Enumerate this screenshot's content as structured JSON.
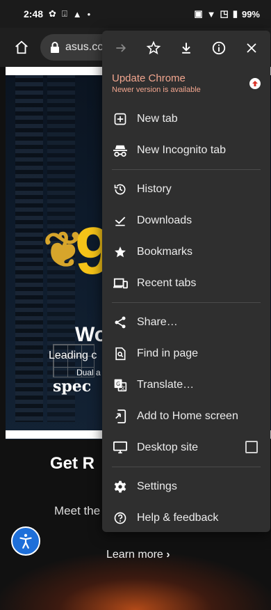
{
  "status_bar": {
    "time": "2:48",
    "battery": "99%"
  },
  "toolbar": {
    "url": "asus.com"
  },
  "page": {
    "hero_wo": "Wo",
    "hero_leading": "Leading c",
    "hero_dual": "Dual a",
    "spec_logo": "spec",
    "big_number": "9",
    "get_r": "Get R",
    "meet": "Meet the",
    "learn_more": "Learn more",
    "learn_more_arrow": "›"
  },
  "menu": {
    "update_title": "Update Chrome",
    "update_subtitle": "Newer version is available",
    "items": [
      {
        "label": "New tab",
        "icon": "plus-box-icon"
      },
      {
        "label": "New Incognito tab",
        "icon": "incognito-icon"
      },
      {
        "label": "History",
        "icon": "history-icon"
      },
      {
        "label": "Downloads",
        "icon": "download-done-icon"
      },
      {
        "label": "Bookmarks",
        "icon": "star-icon"
      },
      {
        "label": "Recent tabs",
        "icon": "devices-icon"
      },
      {
        "label": "Share…",
        "icon": "share-icon"
      },
      {
        "label": "Find in page",
        "icon": "find-in-page-icon"
      },
      {
        "label": "Translate…",
        "icon": "translate-icon"
      },
      {
        "label": "Add to Home screen",
        "icon": "add-to-home-icon"
      },
      {
        "label": "Desktop site",
        "icon": "desktop-icon"
      },
      {
        "label": "Settings",
        "icon": "gear-icon"
      },
      {
        "label": "Help & feedback",
        "icon": "help-icon"
      }
    ]
  },
  "colors": {
    "menu_bg": "#2f2f2f",
    "update_accent": "#f2a68f",
    "a11y_blue": "#1e6fd9"
  }
}
